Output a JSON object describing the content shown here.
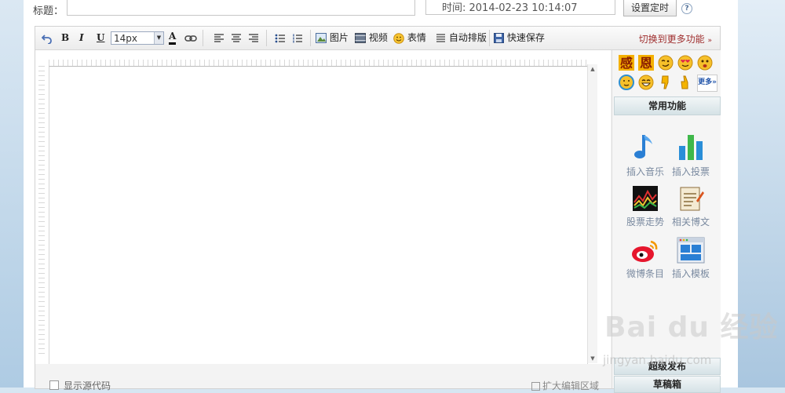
{
  "form": {
    "title_label": "标题：",
    "title_value": "",
    "time_text": "时间: 2014-02-23 10:14:07",
    "set_time_button": "设置定时",
    "help_glyph": "?"
  },
  "toolbar": {
    "bold": "B",
    "italic": "I",
    "underline": "U",
    "font_size": "14px",
    "font_color_glyph": "A",
    "image_label": "图片",
    "video_label": "视频",
    "emoji_label": "表情",
    "auto_layout_label": "自动排版",
    "quick_save_label": "快速保存",
    "more_functions": "切换到更多功能"
  },
  "editor": {
    "show_source_label": "显示源代码",
    "expand_label": "扩大编辑区域"
  },
  "sidebar": {
    "emoticons": [
      {
        "name": "gratitude-text-emoticon",
        "text": "感"
      },
      {
        "name": "gratitude-text-emoticon-2",
        "text": "恩"
      },
      {
        "name": "wink-emoticon"
      },
      {
        "name": "heart-eyes-emoticon"
      },
      {
        "name": "surprised-emoticon"
      },
      {
        "name": "blush-emoticon"
      },
      {
        "name": "laugh-emoticon"
      },
      {
        "name": "thumbs-down-emoticon"
      },
      {
        "name": "thumbs-up-emoticon"
      },
      {
        "name": "more-emoticons",
        "text": "更多»"
      }
    ],
    "common_functions_heading": "常用功能",
    "functions": [
      {
        "label": "插入音乐",
        "icon": "music-note-icon"
      },
      {
        "label": "插入投票",
        "icon": "bar-chart-icon"
      },
      {
        "label": "股票走势",
        "icon": "stock-chart-icon"
      },
      {
        "label": "相关博文",
        "icon": "notepad-icon"
      },
      {
        "label": "微博条目",
        "icon": "weibo-icon"
      },
      {
        "label": "插入模板",
        "icon": "template-icon"
      }
    ],
    "draft_box_label": "草稿箱",
    "publish_label": "超级发布"
  },
  "watermark": {
    "main": "Bai du 经验",
    "url": "jingyan.baidu.com"
  },
  "colors": {
    "accent_red": "#a03030",
    "heading_bg": "#d5e2e6",
    "function_label": "#7a8aa0"
  }
}
